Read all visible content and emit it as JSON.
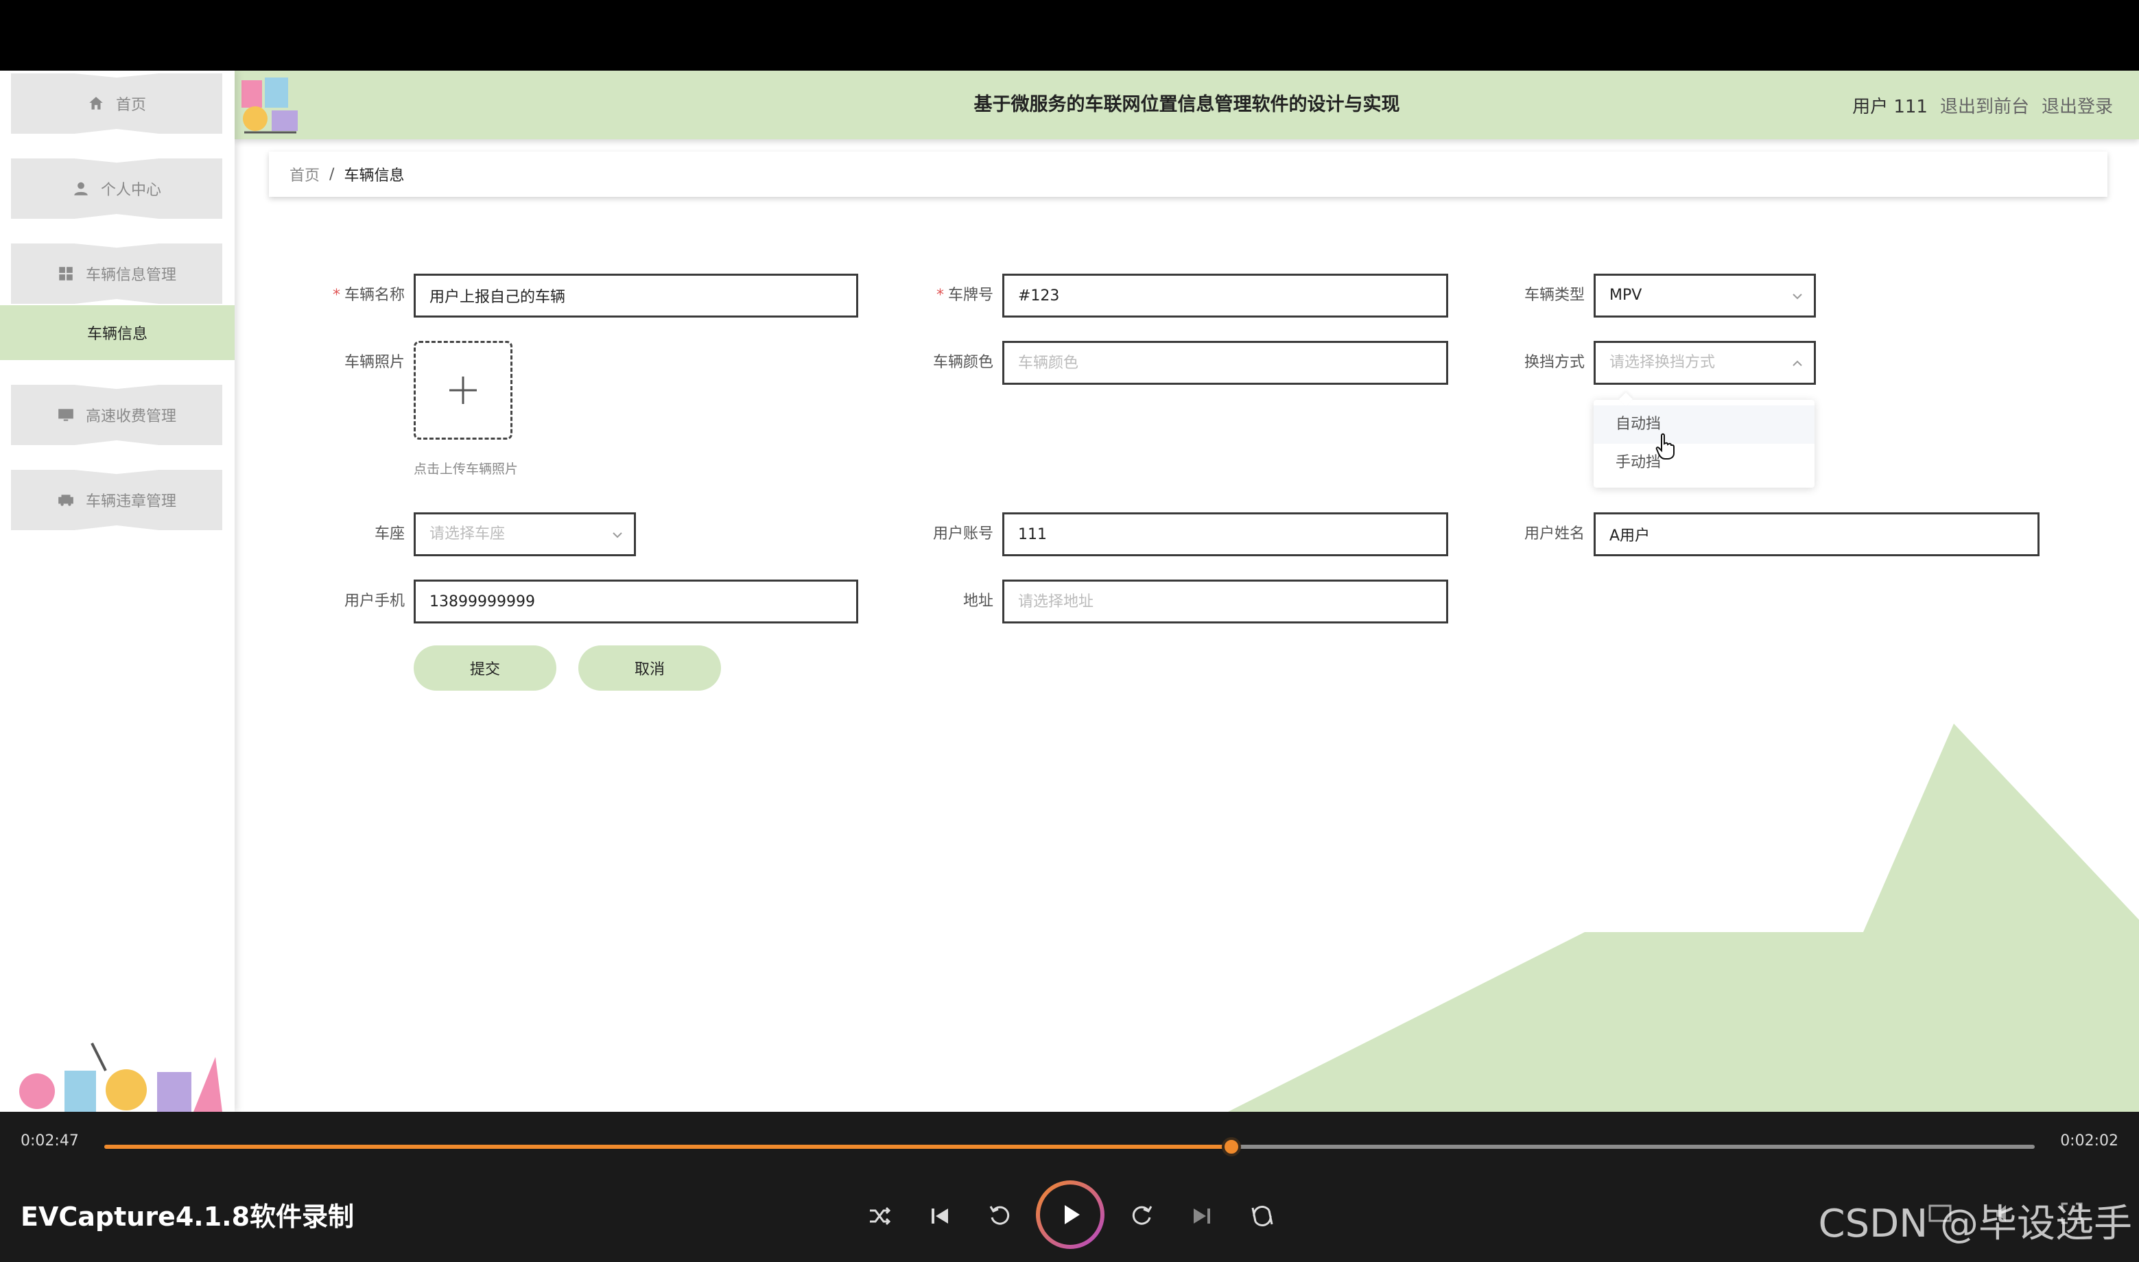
{
  "sidebar": {
    "items": [
      {
        "label": "首页",
        "icon": "home-icon"
      },
      {
        "label": "个人中心",
        "icon": "person-icon"
      },
      {
        "label": "车辆信息管理",
        "icon": "grid-icon"
      },
      {
        "label": "高速收费管理",
        "icon": "monitor-icon"
      },
      {
        "label": "车辆违章管理",
        "icon": "car-icon"
      }
    ],
    "active_sub": "车辆信息"
  },
  "header": {
    "title": "基于微服务的车联网位置信息管理软件的设计与实现",
    "user": "用户 111",
    "links": [
      "退出到前台",
      "退出登录"
    ]
  },
  "breadcrumb": {
    "home": "首页",
    "sep": "/",
    "current": "车辆信息"
  },
  "form": {
    "vehicle_name": {
      "label": "车辆名称",
      "value": "用户上报自己的车辆",
      "required": true
    },
    "plate": {
      "label": "车牌号",
      "value": "#123",
      "required": true
    },
    "vehicle_type": {
      "label": "车辆类型",
      "value": "MPV"
    },
    "photo": {
      "label": "车辆照片",
      "tip": "点击上传车辆照片"
    },
    "color": {
      "label": "车辆颜色",
      "placeholder": "车辆颜色"
    },
    "gear": {
      "label": "换挡方式",
      "placeholder": "请选择换挡方式",
      "options": [
        "自动挡",
        "手动挡"
      ]
    },
    "seat": {
      "label": "车座",
      "placeholder": "请选择车座"
    },
    "account": {
      "label": "用户账号",
      "value": "111"
    },
    "username": {
      "label": "用户姓名",
      "value": "A用户"
    },
    "phone": {
      "label": "用户手机",
      "value": "13899999999"
    },
    "address": {
      "label": "地址",
      "placeholder": "请选择地址"
    },
    "submit": "提交",
    "cancel": "取消",
    "required_mark": "*"
  },
  "player": {
    "elapsed": "0:02:47",
    "total": "0:02:02",
    "progress": 0.584,
    "recorder": "EVCapture4.1.8软件录制",
    "watermark": "CSDN @毕设选手"
  },
  "colors": {
    "accent": "#d3e6c2",
    "progress": "#f08a2c"
  }
}
